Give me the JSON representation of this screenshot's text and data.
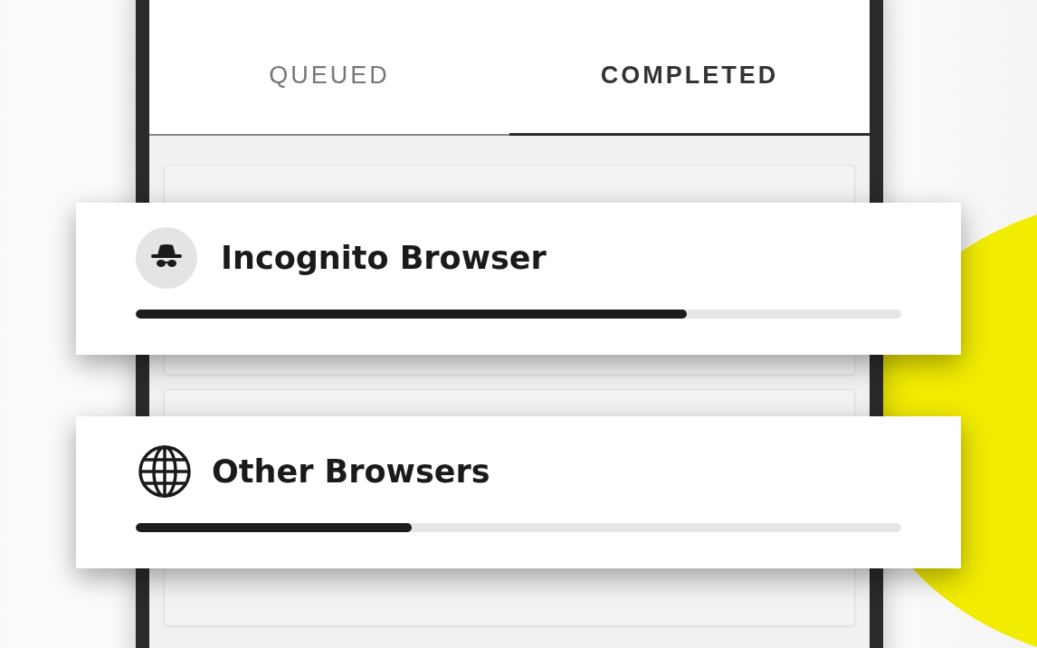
{
  "tabs": [
    {
      "label": "QUEUED",
      "selected": false
    },
    {
      "label": "COMPLETED",
      "selected": true
    }
  ],
  "cards": [
    {
      "kind": "incognito",
      "title": "Incognito Browser",
      "level": 0.72
    },
    {
      "kind": "globe",
      "title": "Other Browsers",
      "level": 0.36
    }
  ]
}
